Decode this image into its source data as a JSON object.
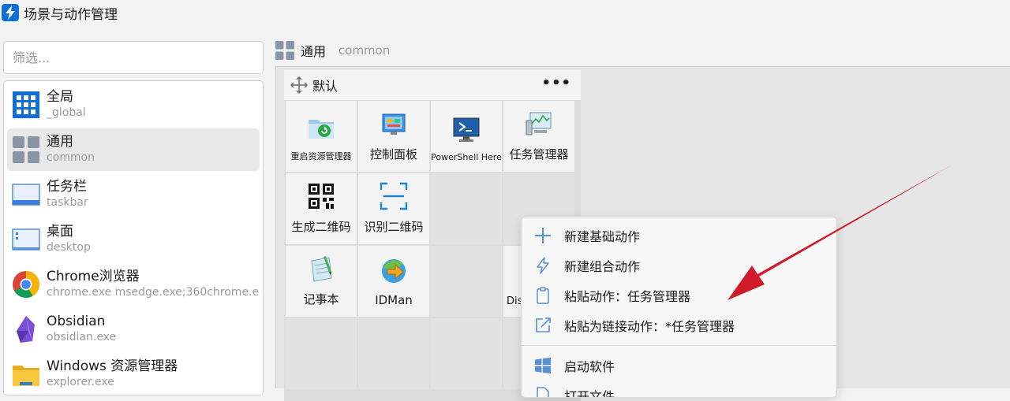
{
  "window": {
    "title": "场景与动作管理"
  },
  "filter": {
    "placeholder": "筛选..."
  },
  "scenes": [
    {
      "name": "全局",
      "sub": "_global",
      "icon": "grid-icon"
    },
    {
      "name": "通用",
      "sub": "common",
      "icon": "tiles-icon",
      "selected": true
    },
    {
      "name": "任务栏",
      "sub": "taskbar",
      "icon": "taskbar-icon"
    },
    {
      "name": "桌面",
      "sub": "desktop",
      "icon": "desktop-icon"
    },
    {
      "name": "Chrome浏览器",
      "sub": "chrome.exe  msedge.exe;360chrome.exe",
      "icon": "chrome-icon"
    },
    {
      "name": "Obsidian",
      "sub": "obsidian.exe",
      "icon": "obsidian-icon"
    },
    {
      "name": "Windows 资源管理器",
      "sub": "explorer.exe",
      "icon": "folder-icon"
    }
  ],
  "breadcrumb": {
    "name": "通用",
    "sub": "common"
  },
  "group": {
    "title": "默认",
    "more": "•••"
  },
  "actions": [
    {
      "label": "重启资源管理器",
      "icon": "restart-explorer-icon"
    },
    {
      "label": "控制面板",
      "icon": "control-panel-icon"
    },
    {
      "label": "PowerShell Here",
      "icon": "powershell-icon"
    },
    {
      "label": "任务管理器",
      "icon": "task-manager-icon"
    },
    {
      "label": "生成二维码",
      "icon": "qrcode-icon"
    },
    {
      "label": "识别二维码",
      "icon": "scan-icon"
    },
    {
      "label": "记事本",
      "icon": "notepad-icon"
    },
    {
      "label": "IDMan",
      "icon": "idman-icon"
    },
    {
      "label": "Dis",
      "icon": ""
    }
  ],
  "context_menu": [
    {
      "label": "新建基础动作",
      "icon": "plus-icon"
    },
    {
      "label": "新建组合动作",
      "icon": "lightning-icon"
    },
    {
      "label": "粘贴动作：任务管理器",
      "icon": "clipboard-icon"
    },
    {
      "label": "粘贴为链接动作：*任务管理器",
      "icon": "link-out-icon"
    },
    {
      "label": "启动软件",
      "icon": "windows-icon"
    },
    {
      "label": "打开文件",
      "icon": "file-icon"
    }
  ],
  "colors": {
    "accent": "#0f6fd6",
    "annotation_arrow": "#d0192a"
  }
}
